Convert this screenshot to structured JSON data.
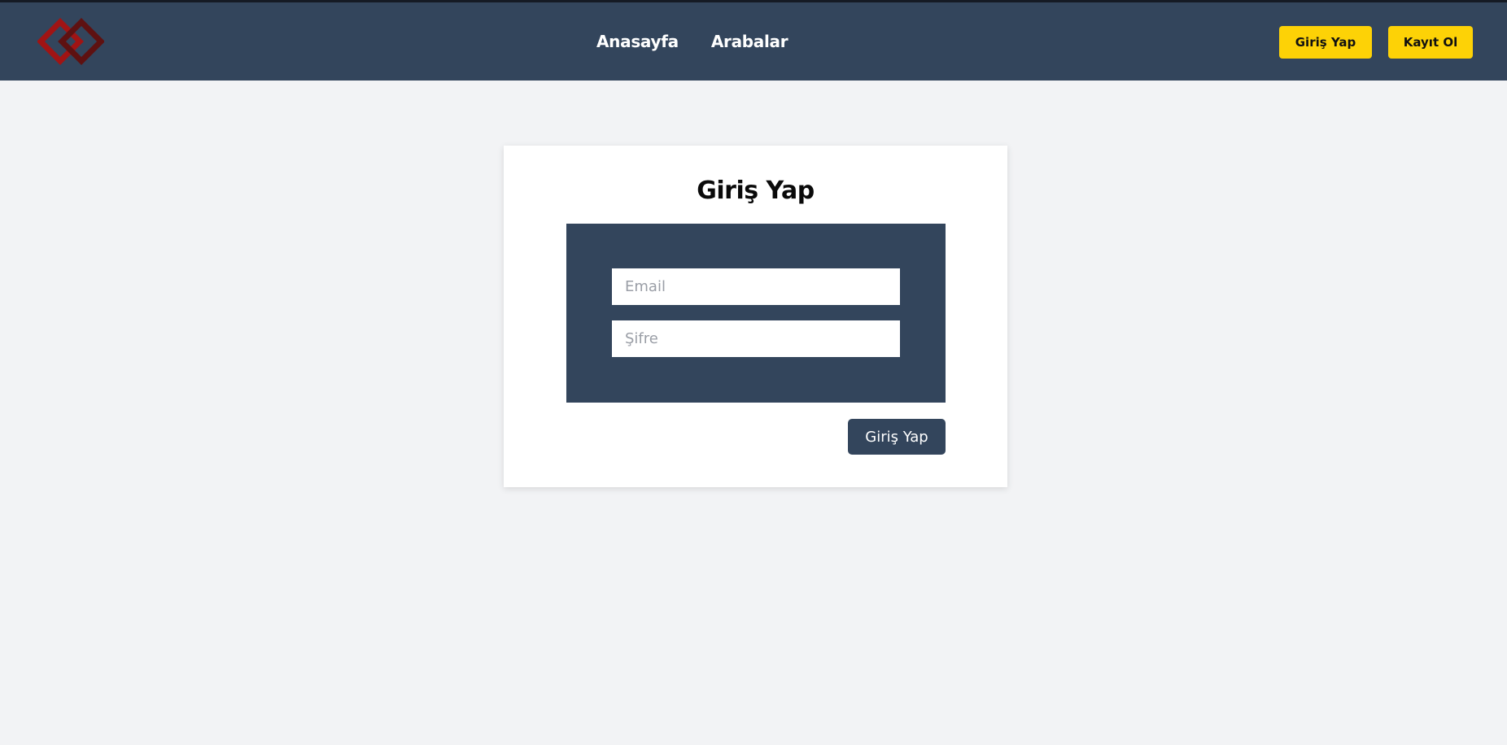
{
  "navbar": {
    "logo_icon": "interlocking-diamonds-logo",
    "links": [
      {
        "label": "Anasayfa"
      },
      {
        "label": "Arabalar"
      }
    ],
    "login_label": "Giriş Yap",
    "register_label": "Kayıt Ol"
  },
  "login_card": {
    "title": "Giriş Yap",
    "email_placeholder": "Email",
    "password_placeholder": "Şifre",
    "submit_label": "Giriş Yap"
  },
  "colors": {
    "navbar_bg": "#33455c",
    "accent_yellow": "#fdd206",
    "page_bg": "#f2f3f5",
    "logo_red": "#8b1a1a"
  }
}
